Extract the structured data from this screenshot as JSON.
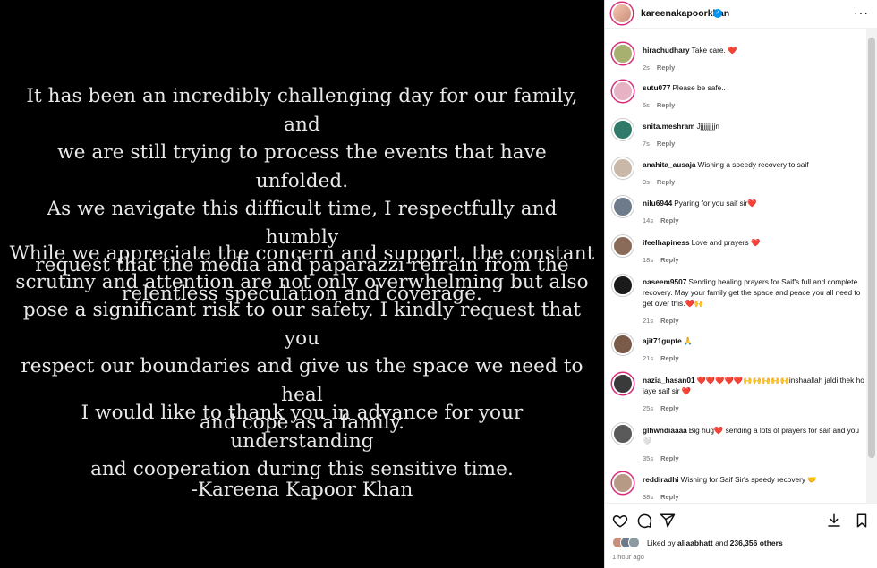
{
  "post": {
    "paragraphs": [
      [
        "It has been an incredibly challenging day for our family, and",
        "we are still trying to process the events that have unfolded.",
        "As we navigate this difficult time, I respectfully and humbly",
        "request that the media and paparazzi refrain from the",
        "relentless speculation and coverage."
      ],
      [
        "While we appreciate the concern and support, the constant",
        "scrutiny and attention are not only overwhelming but also",
        "pose a significant risk to our safety. I kindly request that you",
        "respect our boundaries and give us the space we need to heal",
        "and cope as a family."
      ],
      [
        "I would like to thank you in advance for your understanding",
        "and cooperation during this sensitive time."
      ]
    ],
    "signoff": "-Kareena Kapoor Khan"
  },
  "header": {
    "username": "kareenakapoorkhan",
    "verified_mark": "✓",
    "more": "···"
  },
  "comments": [
    {
      "user": "hirachudhary",
      "text": "Take care. ❤️",
      "time": "2s",
      "reply": "Reply",
      "avatar_color": "#a8b070",
      "story": true
    },
    {
      "user": "sutu077",
      "text": "Please be safe..",
      "time": "6s",
      "reply": "Reply",
      "avatar_color": "#e7b3c4",
      "story": true
    },
    {
      "user": "snita.meshram",
      "text": "Jjjjjjjjjjn",
      "time": "7s",
      "reply": "Reply",
      "avatar_color": "#2f7a6b",
      "story": false
    },
    {
      "user": "anahita_ausaja",
      "text": "Wishing a speedy recovery to saif",
      "time": "9s",
      "reply": "Reply",
      "avatar_color": "#c9b8a8",
      "story": false
    },
    {
      "user": "nilu6944",
      "text": "Pyaring for you saif sir❤️",
      "time": "14s",
      "reply": "Reply",
      "avatar_color": "#6d7b8a",
      "story": false
    },
    {
      "user": "ifeelhapiness",
      "text": "Love and prayers ❤️",
      "time": "18s",
      "reply": "Reply",
      "avatar_color": "#8a6b5a",
      "story": false
    },
    {
      "user": "naseem9507",
      "text": "Sending healing prayers for Saif's full and complete recovery. May your family get the space and peace you all need to get over this.❤️🙌",
      "time": "21s",
      "reply": "Reply",
      "avatar_color": "#1a1a1a",
      "story": false
    },
    {
      "user": "ajit71gupte",
      "text": "🙏",
      "time": "21s",
      "reply": "Reply",
      "avatar_color": "#7a5a48",
      "story": false
    },
    {
      "user": "nazia_hasan01",
      "text": "❤️❤️❤️❤️❤️🙌🙌🙌🙌🙌inshaallah jaldi thek ho jaye saif sir ❤️",
      "time": "25s",
      "reply": "Reply",
      "avatar_color": "#3a3a3a",
      "story": true
    },
    {
      "user": "glhwndiaaaa",
      "text": "Big hug❤️  sending a lots of prayers for saif and you🤍",
      "time": "35s",
      "reply": "Reply",
      "avatar_color": "#5a5a5a",
      "story": false
    },
    {
      "user": "reddiradhi",
      "text": "Wishing for Saif Sir's speedy recovery 🤝",
      "time": "38s",
      "reply": "Reply",
      "avatar_color": "#b79a86",
      "story": true
    }
  ],
  "footer": {
    "liked_prefix": "Liked by ",
    "liked_user": "aliaabhatt",
    "liked_mid": " and ",
    "liked_count": "236,356 others",
    "time_ago": "1 hour ago"
  },
  "colors": {
    "accent": "#0095f6",
    "story_ring": "#d62976",
    "heart": "#ed4956"
  }
}
